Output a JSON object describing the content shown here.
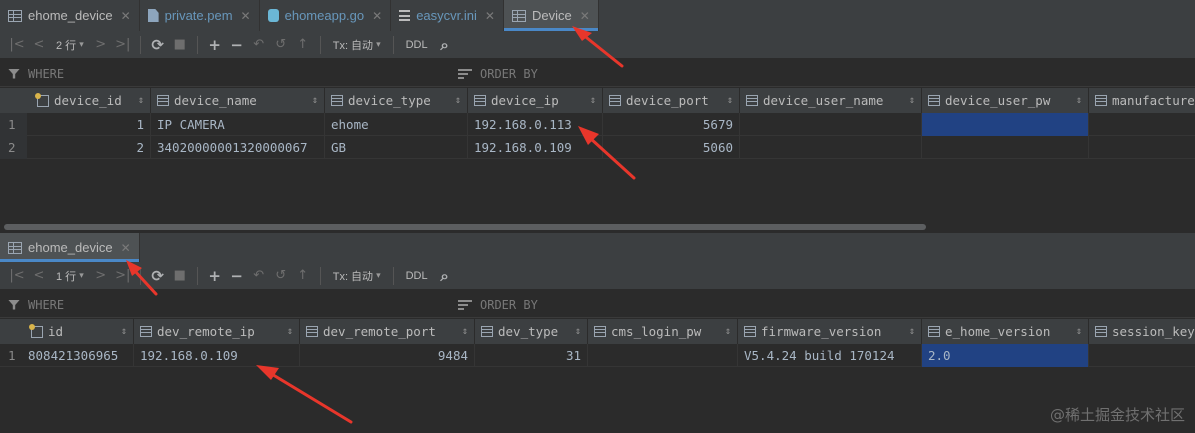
{
  "top_tabs": [
    {
      "label": "ehome_device",
      "icon": "table-icon",
      "blue": false,
      "active": false
    },
    {
      "label": "private.pem",
      "icon": "file-icon",
      "blue": true,
      "active": false
    },
    {
      "label": "ehomeapp.go",
      "icon": "go-file-icon",
      "blue": true,
      "active": false
    },
    {
      "label": "easycvr.ini",
      "icon": "ini-file-icon",
      "blue": true,
      "active": false
    },
    {
      "label": "Device",
      "icon": "table-icon",
      "blue": false,
      "active": true
    }
  ],
  "top_toolbar": {
    "rows": "2 行",
    "tx": "Tx: 自动",
    "ddl": "DDL"
  },
  "bottom_toolbar": {
    "rows": "1 行",
    "tx": "Tx: 自动",
    "ddl": "DDL"
  },
  "filter": {
    "where": "WHERE",
    "order_by": "ORDER BY"
  },
  "top_grid": {
    "columns": [
      "device_id",
      "device_name",
      "device_type",
      "device_ip",
      "device_port",
      "device_user_name",
      "device_user_pw",
      "manufacturer"
    ],
    "rows": [
      {
        "num": "1",
        "cells": [
          "1",
          "IP CAMERA",
          "ehome",
          "192.168.0.113",
          "5679",
          "",
          "",
          ""
        ]
      },
      {
        "num": "2",
        "cells": [
          "2",
          "34020000001320000067",
          "GB",
          "192.168.0.109",
          "5060",
          "",
          "",
          ""
        ]
      }
    ]
  },
  "bottom_tab": {
    "label": "ehome_device",
    "icon": "table-icon"
  },
  "bottom_grid": {
    "columns": [
      "id",
      "dev_remote_ip",
      "dev_remote_port",
      "dev_type",
      "cms_login_pw",
      "firmware_version",
      "e_home_version",
      "session_key"
    ],
    "rows": [
      {
        "num": "1",
        "cells": [
          "808421306965",
          "192.168.0.109",
          "9484",
          "31",
          "",
          "V5.4.24 build 170124",
          "2.0",
          ""
        ]
      }
    ]
  },
  "watermark": "@稀土掘金技术社区",
  "colors": {
    "accent": "#4a88c7",
    "selection": "#214283",
    "arrow": "#e8362b"
  }
}
